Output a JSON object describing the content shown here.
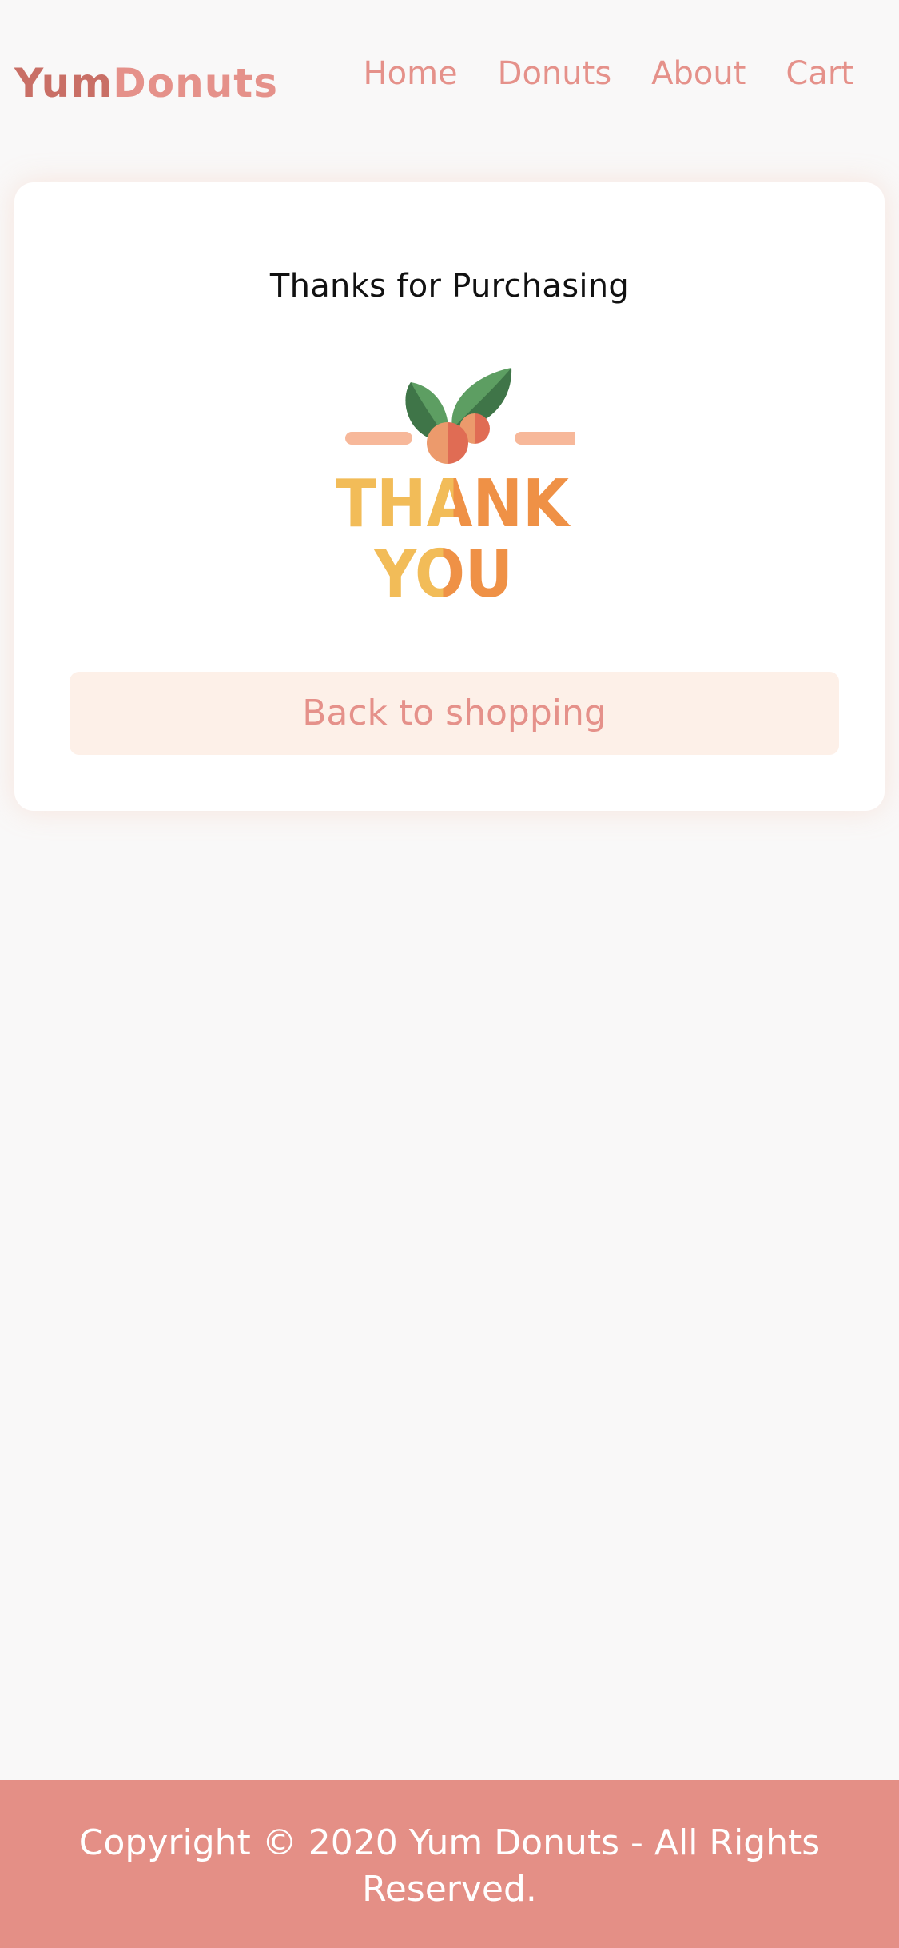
{
  "header": {
    "logo": {
      "part1": "Yum",
      "part2": "Donuts"
    },
    "nav": [
      {
        "label": "Home"
      },
      {
        "label": "Donuts"
      },
      {
        "label": "About"
      },
      {
        "label": "Cart"
      }
    ]
  },
  "card": {
    "title": "Thanks for Purchasing",
    "illustration": {
      "line1": "THANK",
      "line2": "YOU"
    },
    "button_label": "Back to shopping"
  },
  "footer": {
    "copyright": "Copyright © 2020 Yum Donuts - All Rights Reserved."
  },
  "colors": {
    "accent": "#e5918a",
    "logo_dark": "#c96f66",
    "page_bg": "#f9f8f8",
    "button_bg": "#fdf0e8",
    "footer_bg": "#e48f86",
    "thank_yellow": "#f2bc58",
    "thank_orange": "#ef9146",
    "leaf_green": "#5d9e62",
    "leaf_dark": "#3f7548",
    "berry_orange": "#ec9a6c",
    "berry_red": "#e06c54"
  }
}
